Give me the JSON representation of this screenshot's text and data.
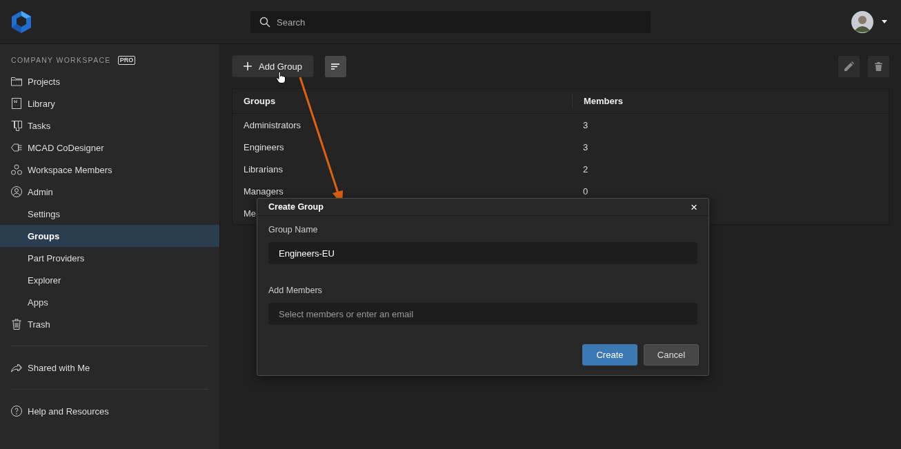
{
  "search": {
    "placeholder": "Search"
  },
  "sidebar": {
    "section": "COMPANY WORKSPACE",
    "badge": "PRO",
    "items": [
      {
        "label": "Projects",
        "kind": "folder",
        "selected": false
      },
      {
        "label": "Library",
        "kind": "library",
        "selected": false
      },
      {
        "label": "Tasks",
        "kind": "tasks",
        "selected": false
      },
      {
        "label": "MCAD CoDesigner",
        "kind": "plug",
        "selected": false
      },
      {
        "label": "Workspace Members",
        "kind": "members",
        "selected": false
      },
      {
        "label": "Admin",
        "kind": "user",
        "selected": false
      },
      {
        "label": "Settings",
        "kind": "sub",
        "selected": false
      },
      {
        "label": "Groups",
        "kind": "sub",
        "selected": true
      },
      {
        "label": "Part Providers",
        "kind": "sub",
        "selected": false
      },
      {
        "label": "Explorer",
        "kind": "sub",
        "selected": false
      },
      {
        "label": "Apps",
        "kind": "sub",
        "selected": false
      },
      {
        "label": "Trash",
        "kind": "trash",
        "selected": false
      }
    ],
    "shared": {
      "label": "Shared with Me"
    },
    "help": {
      "label": "Help and Resources"
    }
  },
  "toolbar": {
    "add_button": "Add Group"
  },
  "table": {
    "columns": [
      "Groups",
      "Members"
    ],
    "rows": [
      {
        "group": "Administrators",
        "members": "3"
      },
      {
        "group": "Engineers",
        "members": "3"
      },
      {
        "group": "Librarians",
        "members": "2"
      },
      {
        "group": "Managers",
        "members": "0"
      },
      {
        "group": "Me"
      }
    ]
  },
  "dialog": {
    "title": "Create Group",
    "close": "×",
    "fields": [
      {
        "label": "Group Name",
        "value": "Engineers-EU"
      },
      {
        "label": "Add Members",
        "placeholder": "Select members or enter an email"
      }
    ],
    "buttons": [
      {
        "label": "Create",
        "kind": "primary"
      },
      {
        "label": "Cancel",
        "kind": "secondary"
      }
    ]
  }
}
